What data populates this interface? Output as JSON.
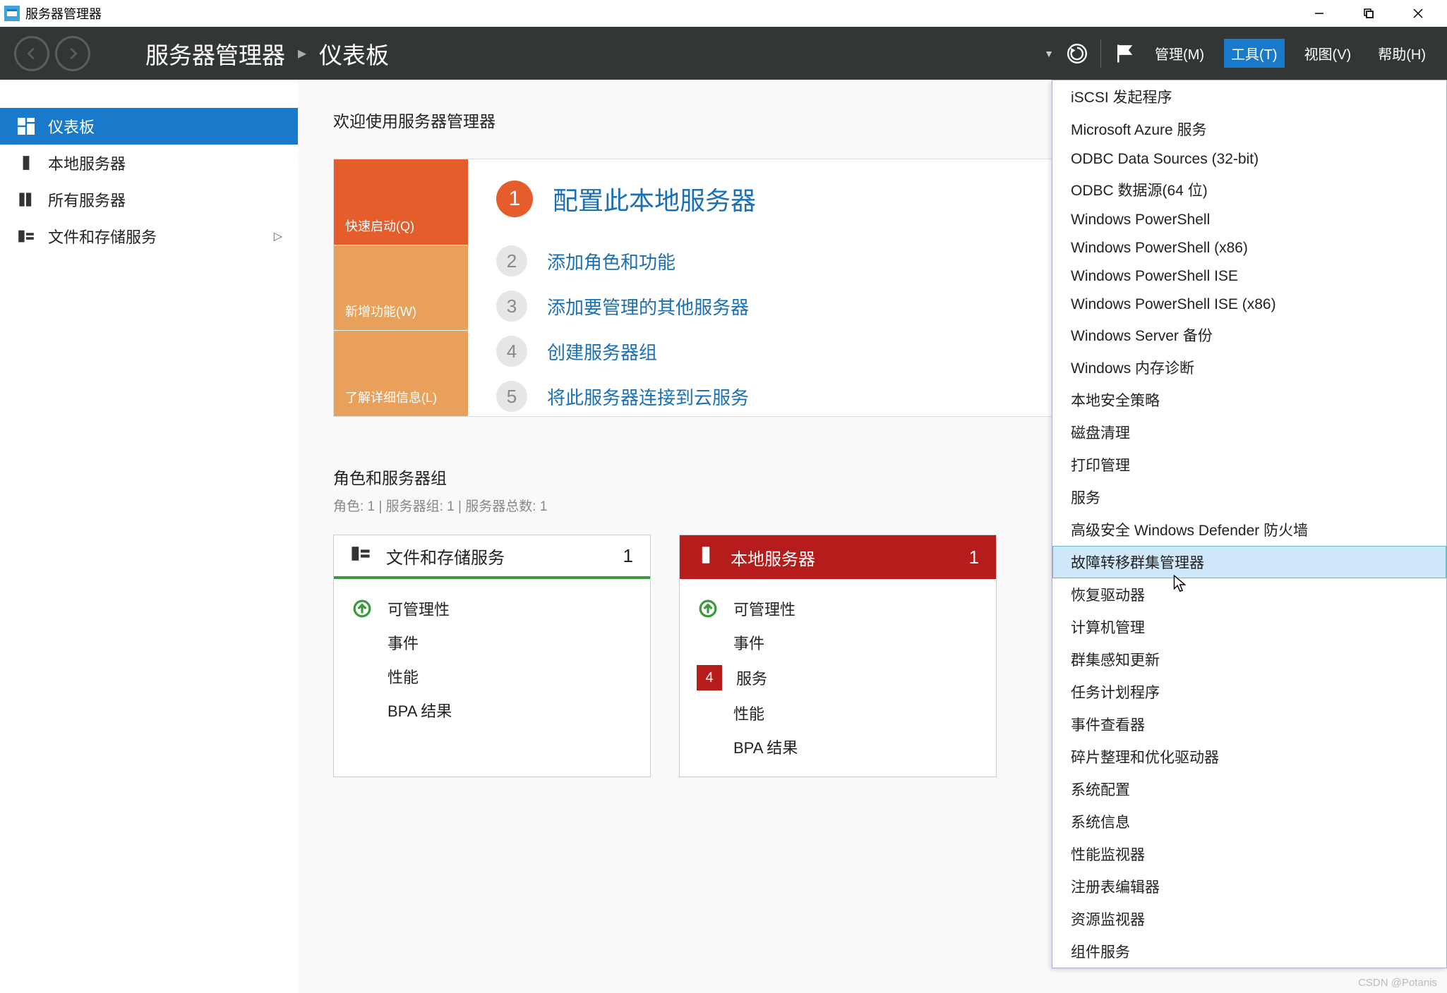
{
  "titlebar": {
    "title": "服务器管理器"
  },
  "header": {
    "breadcrumb": {
      "app": "服务器管理器",
      "page": "仪表板"
    },
    "menu": {
      "manage": "管理(M)",
      "tools": "工具(T)",
      "view": "视图(V)",
      "help": "帮助(H)"
    }
  },
  "sidebar": {
    "items": [
      {
        "label": "仪表板"
      },
      {
        "label": "本地服务器"
      },
      {
        "label": "所有服务器"
      },
      {
        "label": "文件和存储服务"
      }
    ]
  },
  "main": {
    "welcome": "欢迎使用服务器管理器",
    "qs_left": {
      "b1": "快速启动(Q)",
      "b2": "新增功能(W)",
      "b3": "了解详细信息(L)"
    },
    "steps": [
      {
        "num": "1",
        "text": "配置此本地服务器"
      },
      {
        "num": "2",
        "text": "添加角色和功能"
      },
      {
        "num": "3",
        "text": "添加要管理的其他服务器"
      },
      {
        "num": "4",
        "text": "创建服务器组"
      },
      {
        "num": "5",
        "text": "将此服务器连接到云服务"
      }
    ],
    "roles_title": "角色和服务器组",
    "roles_sub": "角色: 1 | 服务器组: 1 | 服务器总数: 1",
    "tiles": [
      {
        "title": "文件和存储服务",
        "count": "1",
        "rows": [
          {
            "icon": "arrow",
            "label": "可管理性"
          },
          {
            "icon": "none",
            "label": "事件"
          },
          {
            "icon": "none",
            "label": "性能"
          },
          {
            "icon": "none",
            "label": "BPA 结果"
          }
        ]
      },
      {
        "title": "本地服务器",
        "count": "1",
        "rows": [
          {
            "icon": "arrow",
            "label": "可管理性"
          },
          {
            "icon": "none",
            "label": "事件"
          },
          {
            "icon": "badge",
            "badge": "4",
            "label": "服务"
          },
          {
            "icon": "none",
            "label": "性能"
          },
          {
            "icon": "none",
            "label": "BPA 结果"
          }
        ]
      }
    ]
  },
  "dropdown": {
    "items": [
      "iSCSI 发起程序",
      "Microsoft Azure 服务",
      "ODBC Data Sources (32-bit)",
      "ODBC 数据源(64 位)",
      "Windows PowerShell",
      "Windows PowerShell (x86)",
      "Windows PowerShell ISE",
      "Windows PowerShell ISE (x86)",
      "Windows Server 备份",
      "Windows 内存诊断",
      "本地安全策略",
      "磁盘清理",
      "打印管理",
      "服务",
      "高级安全 Windows Defender 防火墙",
      "故障转移群集管理器",
      "恢复驱动器",
      "计算机管理",
      "群集感知更新",
      "任务计划程序",
      "事件查看器",
      "碎片整理和优化驱动器",
      "系统配置",
      "系统信息",
      "性能监视器",
      "注册表编辑器",
      "资源监视器",
      "组件服务"
    ],
    "hover_index": 15
  },
  "watermark": "CSDN @Potanis"
}
